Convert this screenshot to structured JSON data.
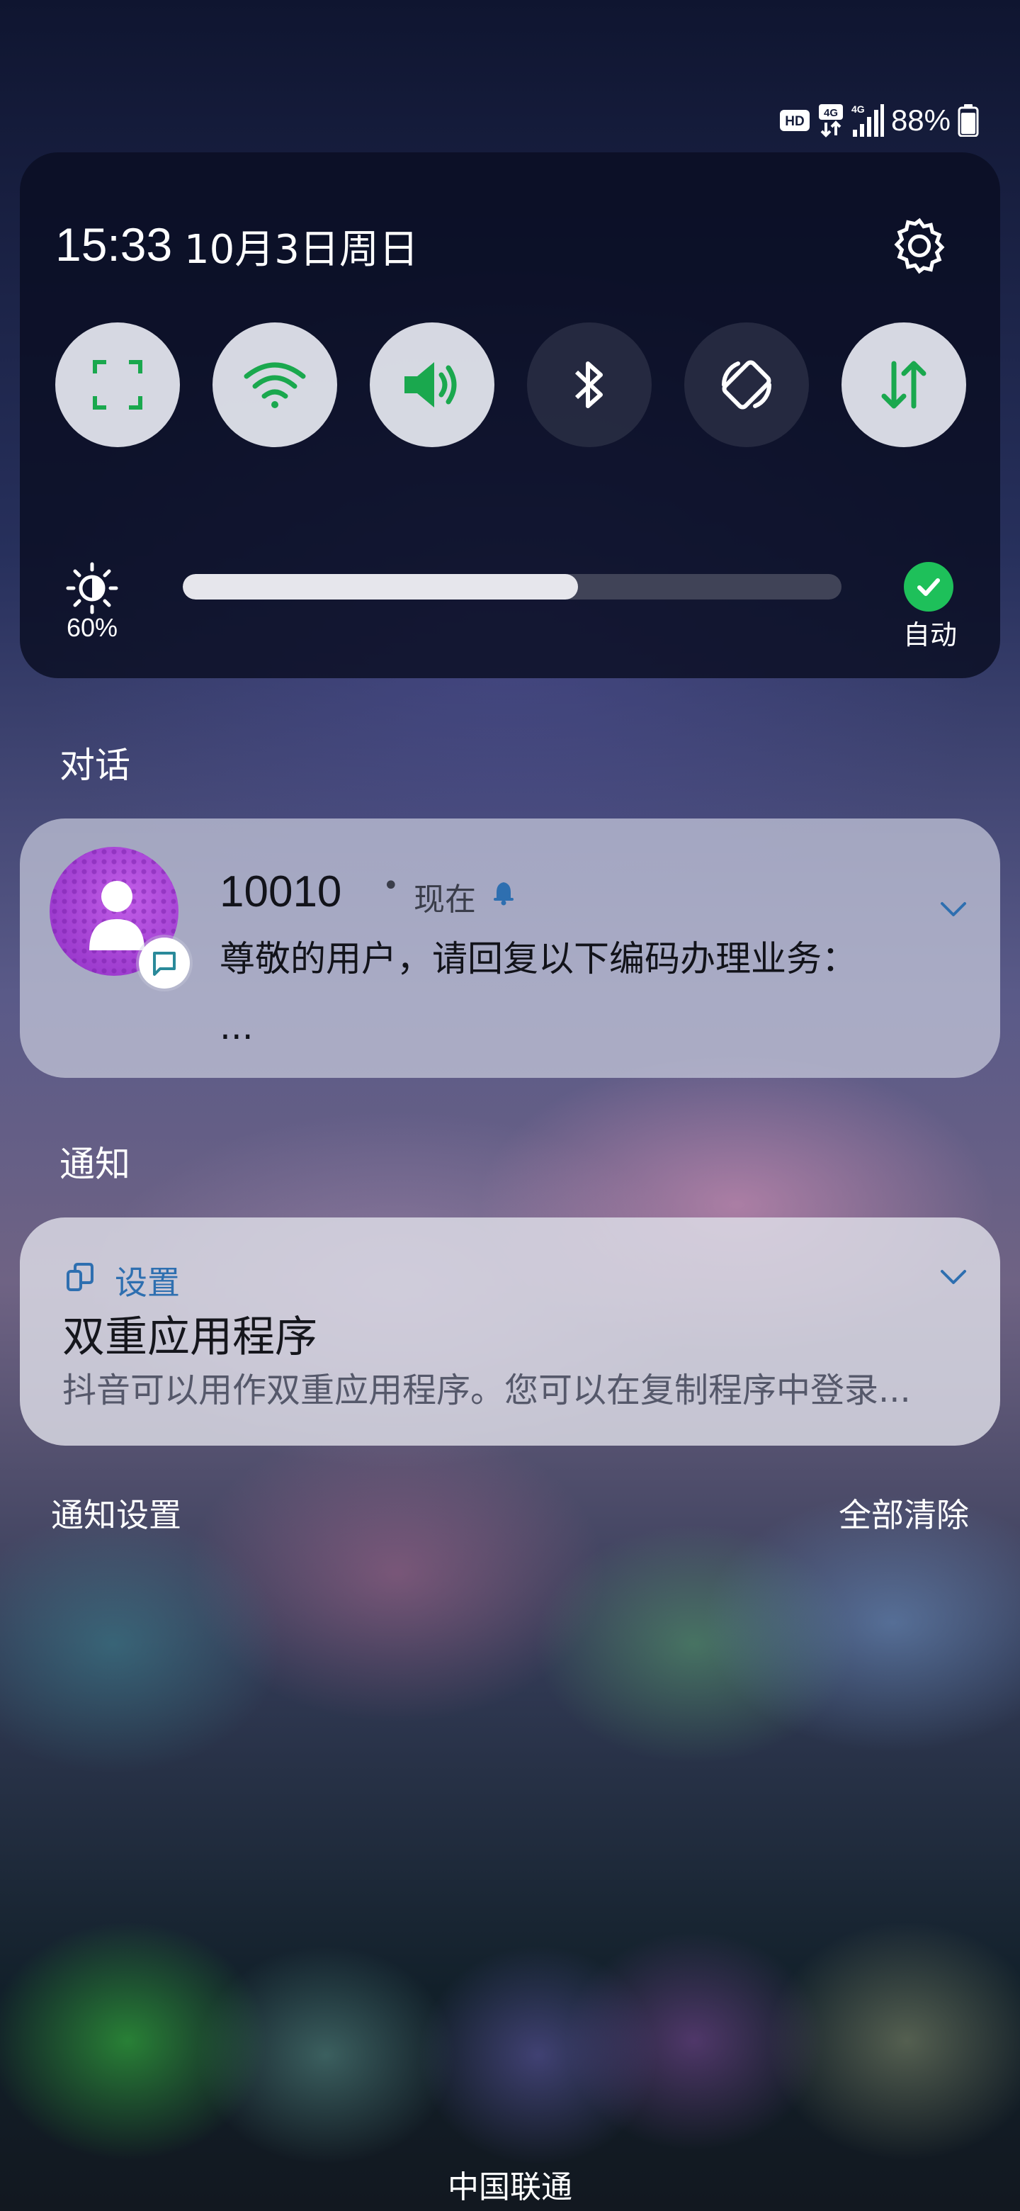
{
  "status_bar": {
    "hd_label": "HD",
    "network_label": "4G",
    "signal_label": "4G",
    "battery_percent": "88%",
    "battery_level": 0.88
  },
  "quick_panel": {
    "time": "15:33",
    "date": "10月3日周日",
    "tiles": [
      {
        "name": "screenshot",
        "icon": "screenshot-frame-icon",
        "state": "on"
      },
      {
        "name": "wifi",
        "icon": "wifi-icon",
        "state": "on"
      },
      {
        "name": "sound",
        "icon": "speaker-icon",
        "state": "on"
      },
      {
        "name": "bluetooth",
        "icon": "bluetooth-icon",
        "state": "off"
      },
      {
        "name": "auto-rotate",
        "icon": "rotate-icon",
        "state": "off"
      },
      {
        "name": "mobile-data",
        "icon": "data-arrows-icon",
        "state": "on"
      }
    ],
    "brightness": {
      "percent_label": "60%",
      "level": 0.6,
      "auto_label": "自动"
    }
  },
  "conversations": {
    "section_title": "对话",
    "item": {
      "sender": "10010",
      "separator": "•",
      "time": "现在",
      "message": "尊敬的用户，请回复以下编码办理业务： ..."
    }
  },
  "notifications": {
    "section_title": "通知",
    "item": {
      "app_name": "设置",
      "title": "双重应用程序",
      "body": "抖音可以用作双重应用程序。您可以在复制程序中登录..."
    }
  },
  "footer": {
    "settings_label": "通知设置",
    "clear_label": "全部清除"
  },
  "carrier": "中国联通",
  "colors": {
    "accent_green": "#1ec05a",
    "link_blue": "#2e6fb0"
  }
}
